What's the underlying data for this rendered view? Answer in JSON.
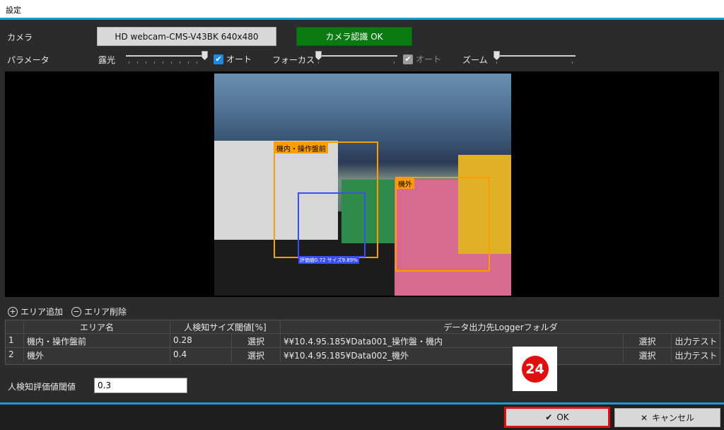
{
  "window": {
    "title": "設定"
  },
  "camera": {
    "label": "カメラ",
    "device": "HD webcam-CMS-V43BK  640x480",
    "status": "カメラ認識 OK"
  },
  "parameters": {
    "label": "パラメータ",
    "exposure": {
      "label": "露光",
      "value": 0.97,
      "auto_label": "オート",
      "auto": true
    },
    "focus": {
      "label": "フォーカス",
      "value": 0.0,
      "auto_label": "オート",
      "auto": true,
      "enabled": false
    },
    "zoom": {
      "label": "ズーム",
      "value": 0.0
    }
  },
  "preview": {
    "zones": [
      {
        "label": "機内・操作盤前"
      },
      {
        "label": "機外"
      }
    ],
    "person_label": "評価値0.72 サイズ9.89%"
  },
  "area_buttons": {
    "add": "エリア追加",
    "remove": "エリア削除"
  },
  "table": {
    "headers": {
      "num": "",
      "name": "エリア名",
      "threshold": "人検知サイズ閾値[%]",
      "folder": "データ出力先Loggerフォルダ"
    },
    "rows": [
      {
        "num": "1",
        "name": "機内・操作盤前",
        "threshold": "0.28",
        "select1": "選択",
        "folder": "¥¥10.4.95.185¥Data001_操作盤・機内",
        "select2": "選択",
        "test": "出力テスト"
      },
      {
        "num": "2",
        "name": "機外",
        "threshold": "0.4",
        "select1": "選択",
        "folder": "¥¥10.4.95.185¥Data002_機外",
        "select2": "選択",
        "test": "出力テスト"
      }
    ]
  },
  "eval_threshold": {
    "label": "人検知評価値閾値",
    "value": "0.3"
  },
  "annotation_badge": "24",
  "footer": {
    "ok": "OK",
    "cancel": "キャンセル"
  },
  "colors": {
    "accent": "#1e9ad6",
    "status_ok": "#0b7a12",
    "zone": "#ff9d00",
    "person": "#3a4ff2",
    "highlight": "#e01010"
  }
}
